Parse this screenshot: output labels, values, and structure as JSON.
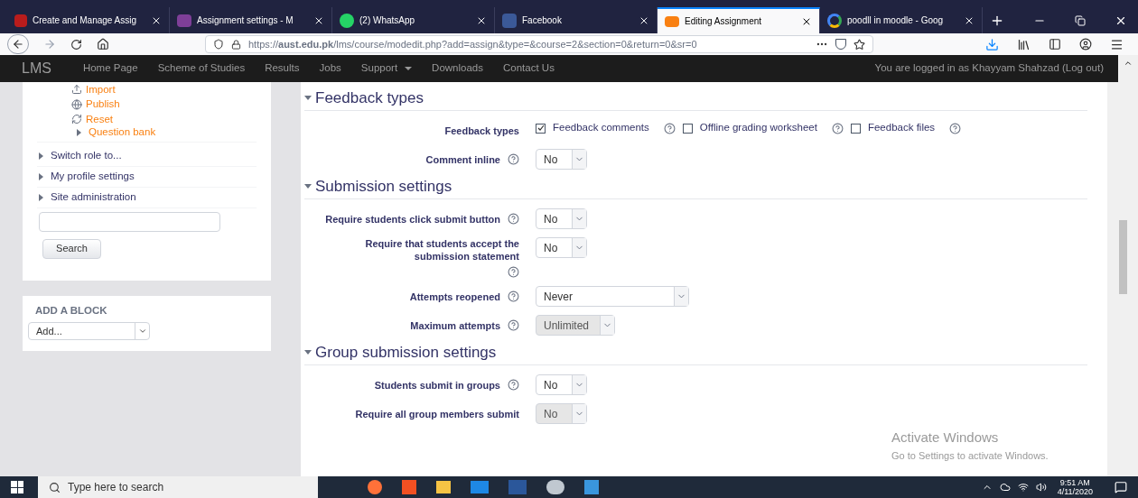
{
  "browser": {
    "tabs": [
      {
        "title": "Create and Manage Assig",
        "selected": false
      },
      {
        "title": "Assignment settings - M",
        "selected": false
      },
      {
        "title": "(2) WhatsApp",
        "selected": false
      },
      {
        "title": "Facebook",
        "selected": false
      },
      {
        "title": "Editing Assignment",
        "selected": true
      },
      {
        "title": "poodll in moodle - Goog",
        "selected": false
      }
    ],
    "url": "https://**aust.edu.pk**/lms/course/modedit.php?add=assign&type=&course=2&section=0&return=0&sr=0"
  },
  "navbar": {
    "brand": "LMS",
    "items": [
      {
        "label": "Home Page",
        "dropdown": false
      },
      {
        "label": "Scheme of Studies",
        "dropdown": false
      },
      {
        "label": "Results",
        "dropdown": false
      },
      {
        "label": "Jobs",
        "dropdown": false
      },
      {
        "label": "Support",
        "dropdown": true
      },
      {
        "label": "Downloads",
        "dropdown": false
      },
      {
        "label": "Contact Us",
        "dropdown": false
      }
    ],
    "login": "You are logged in as Khayyam Shahzad (Log out)"
  },
  "sidebar": {
    "items": [
      {
        "label": "Import",
        "kind": "import"
      },
      {
        "label": "Publish",
        "kind": "publish"
      },
      {
        "label": "Reset",
        "kind": "reset"
      },
      {
        "label": "Question bank",
        "kind": "subnode"
      },
      {
        "label": "Switch role to...",
        "kind": "node"
      },
      {
        "label": "My profile settings",
        "kind": "node"
      },
      {
        "label": "Site administration",
        "kind": "node"
      }
    ],
    "search_button": "Search",
    "add_block": {
      "title": "ADD A BLOCK",
      "value": "Add..."
    }
  },
  "sections": [
    {
      "title": "Feedback types",
      "expanded": true,
      "fields": [
        {
          "label": "Feedback types",
          "kind": "checkboxes",
          "help": false,
          "options": [
            {
              "label": "Feedback comments",
              "checked": true
            },
            {
              "label": "Offline grading worksheet",
              "checked": false
            },
            {
              "label": "Feedback files",
              "checked": false
            }
          ]
        },
        {
          "label": "Comment inline",
          "kind": "select",
          "help": true,
          "value": "No",
          "disabled": false
        }
      ]
    },
    {
      "title": "Submission settings",
      "expanded": true,
      "fields": [
        {
          "label": "Require students click submit button",
          "kind": "select",
          "help": true,
          "value": "No",
          "disabled": false
        },
        {
          "label": "Require that students accept the submission statement",
          "kind": "select",
          "help": true,
          "value": "No",
          "disabled": false
        },
        {
          "label": "Attempts reopened",
          "kind": "select",
          "help": true,
          "value": "Never",
          "disabled": false
        },
        {
          "label": "Maximum attempts",
          "kind": "select",
          "help": true,
          "value": "Unlimited",
          "disabled": true
        }
      ]
    },
    {
      "title": "Group submission settings",
      "expanded": true,
      "fields": [
        {
          "label": "Students submit in groups",
          "kind": "select",
          "help": true,
          "value": "No",
          "disabled": false
        },
        {
          "label": "Require all group members submit",
          "kind": "select",
          "help": false,
          "value": "No",
          "disabled": true
        }
      ]
    }
  ],
  "activation": {
    "title": "Activate Windows",
    "subtitle": "Go to Settings to activate Windows."
  },
  "taskbar": {
    "search_placeholder": "Type here to search",
    "time": "9:51 AM",
    "date": "4/11/2020"
  }
}
